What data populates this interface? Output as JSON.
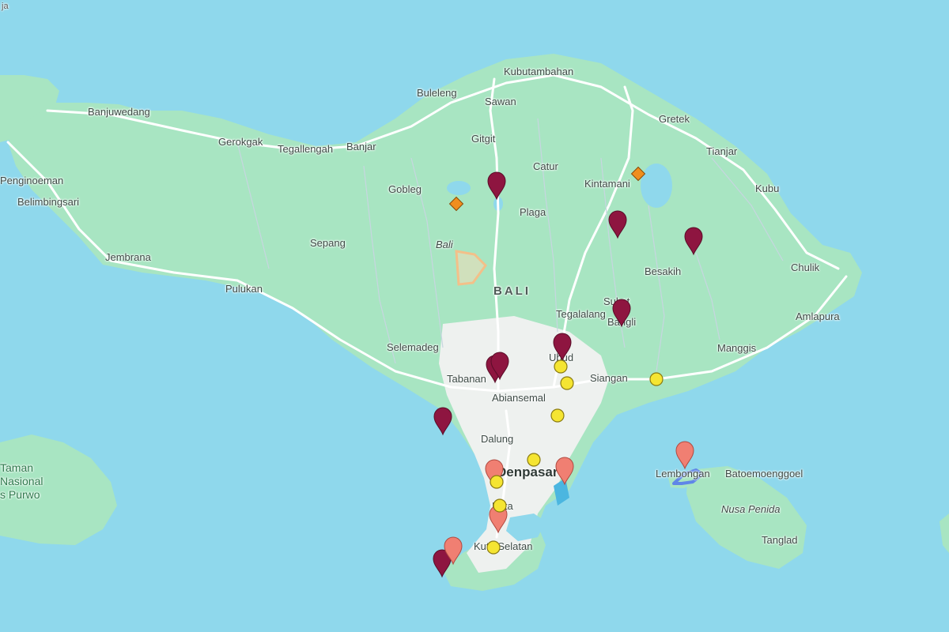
{
  "map": {
    "labels": {
      "corner": "ja",
      "kubutambahan": "Kubutambahan",
      "buleleng": "Buleleng",
      "sawan": "Sawan",
      "banjuwedang": "Banjuwedang",
      "gretek": "Gretek",
      "gerokgak": "Gerokgak",
      "tegallengah": "Tegallengah",
      "banjar": "Banjar",
      "gitgit": "Gitgit",
      "tianjar": "Tianjar",
      "catur": "Catur",
      "penginoeman": "Penginoeman",
      "gobleg": "Gobleg",
      "kintamani": "Kintamani",
      "kubu": "Kubu",
      "belimbingsari": "Belimbingsari",
      "plaga": "Plaga",
      "sepang": "Sepang",
      "bali_mountain": "Bali",
      "jembrana": "Jembrana",
      "chulik": "Chulik",
      "besakih": "Besakih",
      "pulukan": "Pulukan",
      "bali_region": "BALI",
      "tegalalang": "Tegalalang",
      "sukat": "Sukat",
      "bangli": "Bangli",
      "amlapura": "Amlapura",
      "manggis": "Manggis",
      "selemadeg": "Selemadeg",
      "ubud": "Ubud",
      "tabanan": "Tabanan",
      "siangan": "Siangan",
      "abiansemal": "Abiansemal",
      "dalung": "Dalung",
      "park_line1": "Taman",
      "park_line2": "Nasional",
      "park_line3": "s Purwo",
      "denpasar": "Denpasar",
      "lembongan": "Lembongan",
      "batoemoenggoel": "Batoemoenggoel",
      "kuta": "Kuta",
      "nusa_penida": "Nusa Penida",
      "kuta_selatan": "Kuta Selatan",
      "tanglad": "Tanglad"
    },
    "colors": {
      "sea": "#8fd8ec",
      "land": "#a8e5c2",
      "urban": "#eef1ef",
      "road": "#ffffff",
      "marker_dark": "#8e1540",
      "marker_light": "#f07f72",
      "marker_yellow": "#f5e532",
      "marker_orange": "#f08e1e",
      "area_outline": "#f3c089",
      "route": "#5f86e8"
    },
    "markers": {
      "dark_pins": 11,
      "light_pins": 6,
      "yellow_dots": 10,
      "orange_diamonds": 2
    }
  }
}
